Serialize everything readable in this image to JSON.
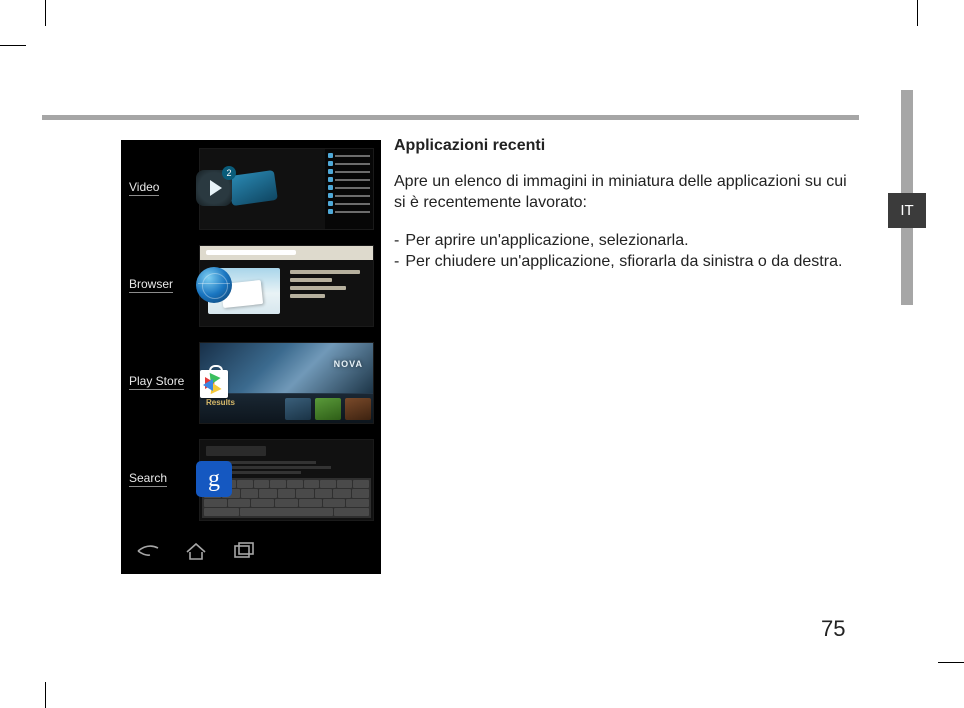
{
  "page_number": "75",
  "language_tab": "IT",
  "text": {
    "heading": "Applicazioni recenti",
    "intro": "Apre un elenco di immagini in miniatura delle applicazioni su cui si è recentemente lavorato:",
    "bullets": [
      "Per aprire un'applicazione, selezionarla.",
      "Per chiudere un'applicazione, sfiorarla da sinistra o da destra."
    ]
  },
  "screenshot": {
    "recent_apps": [
      {
        "label": "Video",
        "icon": "play",
        "badge": "2"
      },
      {
        "label": "Browser",
        "icon": "globe",
        "badge": ""
      },
      {
        "label": "Play Store",
        "icon": "bag",
        "badge": ""
      },
      {
        "label": "Search",
        "icon": "google",
        "badge": ""
      }
    ],
    "store_banner_logo": "NOVA",
    "store_strip_title": "Results",
    "google_glyph": "g"
  }
}
